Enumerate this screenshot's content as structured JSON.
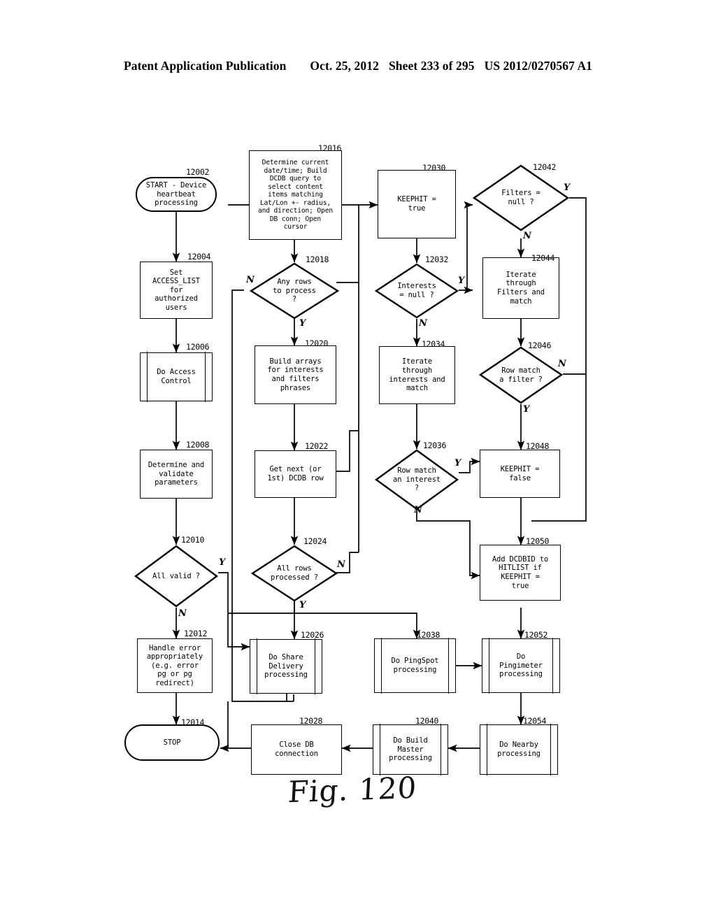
{
  "header": {
    "publication": "Patent Application Publication",
    "date": "Oct. 25, 2012",
    "sheet": "Sheet 233 of 295",
    "document_number": "US 2012/0270567 A1"
  },
  "figure": {
    "caption": "Fig. 120",
    "title": "Device heartbeat processing flowchart"
  },
  "nodes": [
    {
      "id": "12002",
      "ref": "12002",
      "shape": "terminator",
      "text": "START - Device\nheartbeat\nprocessing"
    },
    {
      "id": "12004",
      "ref": "12004",
      "shape": "process",
      "text": "Set\nACCESS_LIST\nfor\nauthorized\nusers"
    },
    {
      "id": "12006",
      "ref": "12006",
      "shape": "predefined-process",
      "text": "Do Access\nControl"
    },
    {
      "id": "12008",
      "ref": "12008",
      "shape": "process",
      "text": "Determine and\nvalidate\nparameters"
    },
    {
      "id": "12010",
      "ref": "12010",
      "shape": "decision",
      "text": "All valid ?"
    },
    {
      "id": "12012",
      "ref": "12012",
      "shape": "process",
      "text": "Handle error\nappropriately\n(e.g. error\npg or pg\nredirect)"
    },
    {
      "id": "12014",
      "ref": "12014",
      "shape": "terminator",
      "text": "STOP"
    },
    {
      "id": "12016",
      "ref": "12016",
      "shape": "process",
      "text": "Determine current\ndate/time; Build\nDCDB query to\nselect content\nitems matching\nLat/Lon +- radius,\nand direction; Open\nDB conn; Open\ncursor"
    },
    {
      "id": "12018",
      "ref": "12018",
      "shape": "decision",
      "text": "Any rows\nto process\n?"
    },
    {
      "id": "12020",
      "ref": "12020",
      "shape": "process",
      "text": "Build arrays\nfor interests\nand filters\nphrases"
    },
    {
      "id": "12022",
      "ref": "12022",
      "shape": "process",
      "text": "Get next (or\n1st) DCDB row"
    },
    {
      "id": "12024",
      "ref": "12024",
      "shape": "decision",
      "text": "All rows\nprocessed ?"
    },
    {
      "id": "12026",
      "ref": "12026",
      "shape": "predefined-process",
      "text": "Do Share\nDelivery\nprocessing"
    },
    {
      "id": "12028",
      "ref": "12028",
      "shape": "process",
      "text": "Close DB\nconnection"
    },
    {
      "id": "12030",
      "ref": "12030",
      "shape": "process",
      "text": "KEEPHIT =\ntrue"
    },
    {
      "id": "12032",
      "ref": "12032",
      "shape": "decision",
      "text": "Interests\n= null ?"
    },
    {
      "id": "12034",
      "ref": "12034",
      "shape": "process",
      "text": "Iterate\nthrough\ninterests and\nmatch"
    },
    {
      "id": "12036",
      "ref": "12036",
      "shape": "decision",
      "text": "Row match\nan interest\n?"
    },
    {
      "id": "12038",
      "ref": "12038",
      "shape": "predefined-process",
      "text": "Do PingSpot\nprocessing"
    },
    {
      "id": "12040",
      "ref": "12040",
      "shape": "predefined-process",
      "text": "Do Build\nMaster\nprocessing"
    },
    {
      "id": "12042",
      "ref": "12042",
      "shape": "decision",
      "text": "Filters =\nnull ?"
    },
    {
      "id": "12044",
      "ref": "12044",
      "shape": "process",
      "text": "Iterate\nthrough\nFilters and\nmatch"
    },
    {
      "id": "12046",
      "ref": "12046",
      "shape": "decision",
      "text": "Row match\na filter ?"
    },
    {
      "id": "12048",
      "ref": "12048",
      "shape": "process",
      "text": "KEEPHIT =\nfalse"
    },
    {
      "id": "12050",
      "ref": "12050",
      "shape": "process",
      "text": "Add DCDBID to\nHITLIST if\nKEEPHIT =\ntrue"
    },
    {
      "id": "12052",
      "ref": "12052",
      "shape": "predefined-process",
      "text": "Do\nPingimeter\nprocessing"
    },
    {
      "id": "12054",
      "ref": "12054",
      "shape": "predefined-process",
      "text": "Do Nearby\nprocessing"
    }
  ],
  "branch_labels": {
    "b12010_y": "Y",
    "b12010_n": "N",
    "b12018_y": "Y",
    "b12018_n": "N",
    "b12024_y": "Y",
    "b12024_n": "N",
    "b12032_y": "Y",
    "b12032_n": "N",
    "b12036_y": "Y",
    "b12036_n": "N",
    "b12042_y": "Y",
    "b12042_n": "N",
    "b12046_y": "Y",
    "b12046_n": "N"
  },
  "colors": {
    "ink": "#000000",
    "paper": "#ffffff"
  }
}
